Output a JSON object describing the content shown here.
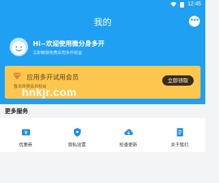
{
  "status_bar": {
    "time": "12:45"
  },
  "header": {
    "title": "我的",
    "chat_icon": "chat-bubble-icon"
  },
  "profile": {
    "avatar_icon": "smiley-avatar-icon",
    "greeting": "Hi~欢迎使用微分身多开",
    "subtitle": "立即解锁免费应用多开权益"
  },
  "vip_card": {
    "icon": "diamond-icon",
    "title": "应用多开试用会员",
    "subtitle": "暂未获得会员权益",
    "button_label": "立即领取",
    "background_color": "#fdc74f",
    "button_color": "#3b2c16"
  },
  "watermark": "hnkjr.com",
  "more_services": {
    "title": "更多服务",
    "items": [
      {
        "label": "优惠券",
        "icon": "coupon-icon"
      },
      {
        "label": "隐私设置",
        "icon": "privacy-shield-icon"
      },
      {
        "label": "检查更新",
        "icon": "cloud-download-icon"
      },
      {
        "label": "关于我们",
        "icon": "document-icon"
      }
    ]
  },
  "colors": {
    "primary": "#1fa0f2",
    "background": "#f3f4f6"
  }
}
